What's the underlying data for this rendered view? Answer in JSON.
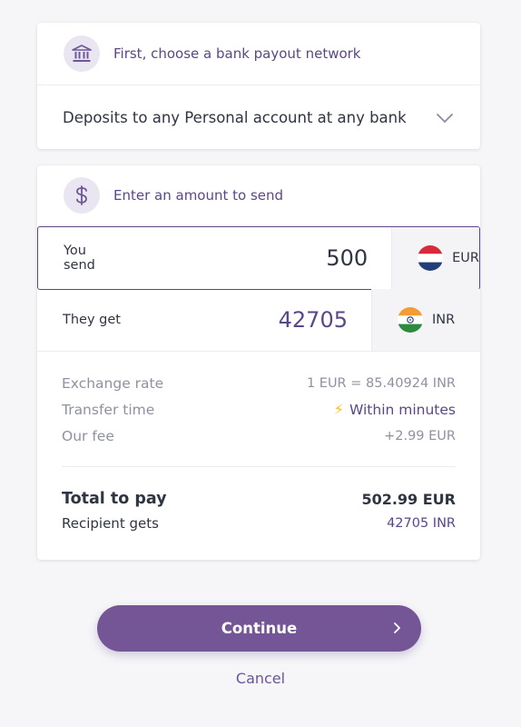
{
  "colors": {
    "accent": "#745696",
    "accent_text": "#5b4787",
    "background": "#f6f6f8",
    "bolt": "#f2c31b"
  },
  "network_card": {
    "icon": "bank-icon",
    "header": "First, choose a bank payout network",
    "selected_network": "Deposits to any Personal account at any bank"
  },
  "amount_card": {
    "icon": "dollar-icon",
    "header": "Enter an amount to send",
    "send": {
      "label": "You send",
      "value": "500",
      "currency": "EUR",
      "flag": "netherlands-flag"
    },
    "get": {
      "label": "They get",
      "value": "42705",
      "currency": "INR",
      "flag": "india-flag"
    },
    "details": {
      "exchange_rate_label": "Exchange rate",
      "exchange_rate_value": "1 EUR = 85.40924 INR",
      "transfer_time_label": "Transfer time",
      "transfer_time_value": "Within minutes",
      "fee_label": "Our fee",
      "fee_value": "+2.99 EUR"
    },
    "totals": {
      "total_label": "Total to pay",
      "total_value": "502.99 EUR",
      "recipient_label": "Recipient gets",
      "recipient_value": "42705 INR"
    }
  },
  "actions": {
    "continue_label": "Continue",
    "cancel_label": "Cancel"
  }
}
